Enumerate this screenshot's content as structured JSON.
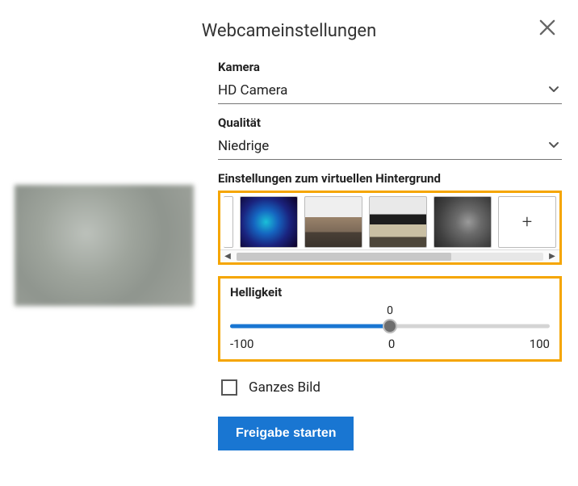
{
  "dialog": {
    "title": "Webcameinstellungen"
  },
  "fields": {
    "camera": {
      "label": "Kamera",
      "value": "HD Camera"
    },
    "quality": {
      "label": "Qualität",
      "value": "Niedrige"
    },
    "virtual_bg": {
      "label": "Einstellungen zum virtuellen Hintergrund",
      "add_icon": "+"
    },
    "brightness": {
      "label": "Helligkeit",
      "value": "0",
      "min": "-100",
      "mid": "0",
      "max": "100"
    },
    "whole_image": {
      "label": "Ganzes Bild",
      "checked": false
    }
  },
  "actions": {
    "start_share": "Freigabe starten"
  }
}
